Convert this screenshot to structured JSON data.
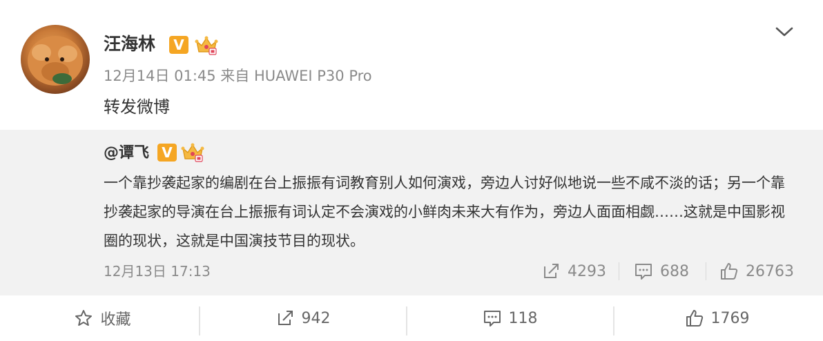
{
  "post": {
    "author": "汪海林",
    "verified_badge": "V",
    "meta": "12月14日 01:45 来自 HUAWEI P30 Pro",
    "text": "转发微博"
  },
  "repost": {
    "author": "@谭飞",
    "verified_badge": "V",
    "text": "一个靠抄袭起家的编剧在台上振振有词教育别人如何演戏，旁边人讨好似地说一些不咸不淡的话；另一个靠抄袭起家的导演在台上振振有词认定不会演戏的小鲜肉未来大有作为，旁边人面面相觑……这就是中国影视圈的现状，这就是中国演技节目的现状。",
    "date": "12月13日 17:13",
    "forwards": "4293",
    "comments": "688",
    "likes": "26763"
  },
  "actions": {
    "favorite_label": "收藏",
    "forward_count": "942",
    "comment_count": "118",
    "like_count": "1769"
  },
  "icons": {
    "menu": "chevron-down-icon",
    "forward": "share-icon",
    "comment": "comment-icon",
    "like": "thumbs-up-icon",
    "favorite": "star-icon",
    "crown": "crown-badge-icon"
  },
  "colors": {
    "verified_badge": "#f5a623",
    "repost_background": "#f2f2f2",
    "meta_text": "#8a8a8a"
  }
}
